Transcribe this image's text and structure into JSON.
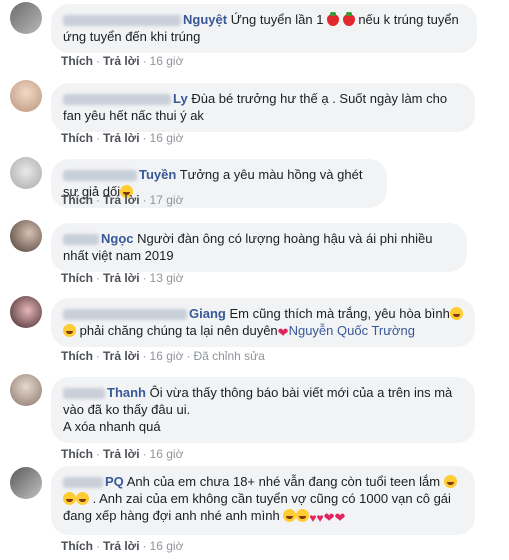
{
  "actions": {
    "like": "Thích",
    "reply": "Trả lời",
    "separator": "·"
  },
  "comments": [
    {
      "author_visible": "Nguyệt",
      "text_before": "Ứng tuyển lần 1 ",
      "text_after": " nếu k trúng tuyển ứng tuyển đến khi trúng",
      "time": "16 giờ"
    },
    {
      "author_visible": "Ly",
      "text": "Đùa bé trưởng hư thế ạ . Suốt ngày làm cho fan yêu hết nấc thui ý ak",
      "time": "16 giờ"
    },
    {
      "author_visible": "Tuyền",
      "text": "Tưởng a yêu màu hồng và ghét sự giả dối",
      "time": "17 giờ"
    },
    {
      "author_visible": "Ngọc",
      "text": "Người đàn ông có lượng hoàng hậu và ái phi nhiều nhất việt nam 2019",
      "time": "13 giờ"
    },
    {
      "author_visible": "Giang",
      "text_before": "Em cũng thích mà trắng, yêu hòa bình",
      "text_mid": " phải chăng chúng ta lại nên duyên",
      "mention": "Nguyễn Quốc Trường",
      "time": "16 giờ",
      "edited": "Đã chỉnh sửa"
    },
    {
      "author_visible": "Thanh",
      "text": "Ôi vừa thấy thông báo bài viết mới của a trên ins mà vào đã ko thấy đâu ui.",
      "text2": "A xóa nhanh quá",
      "time": "16 giờ"
    },
    {
      "author_visible": "PQ",
      "text_before": "Anh của em chưa 18+ nhé vẫn đang còn tuổi teen lắm ",
      "text_mid": " . Anh zai của em không cần tuyển vợ cũng có 1000 vạn cô gái đang xếp hàng đợi anh nhé anh mình ",
      "time": "16 giờ"
    }
  ]
}
